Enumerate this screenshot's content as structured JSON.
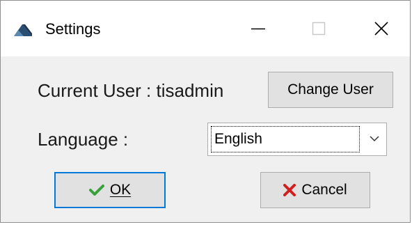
{
  "window": {
    "title": "Settings",
    "icons": {
      "app": "settings-app-icon",
      "minimize": "minimize-icon",
      "maximize": "maximize-icon",
      "close": "close-icon"
    }
  },
  "user": {
    "label": "Current User : tisadmin",
    "change_button": "Change User"
  },
  "language": {
    "label": "Language :",
    "selected": "English",
    "dropdown_icon": "chevron-down-icon"
  },
  "actions": {
    "ok_label": "OK",
    "ok_icon": "checkmark-icon",
    "cancel_label": "Cancel",
    "cancel_icon": "x-mark-icon"
  },
  "colors": {
    "focus_border": "#0078d7",
    "ok_check": "#3aa13a",
    "cancel_x": "#d11f1f",
    "app_icon": "#2a4f73"
  }
}
